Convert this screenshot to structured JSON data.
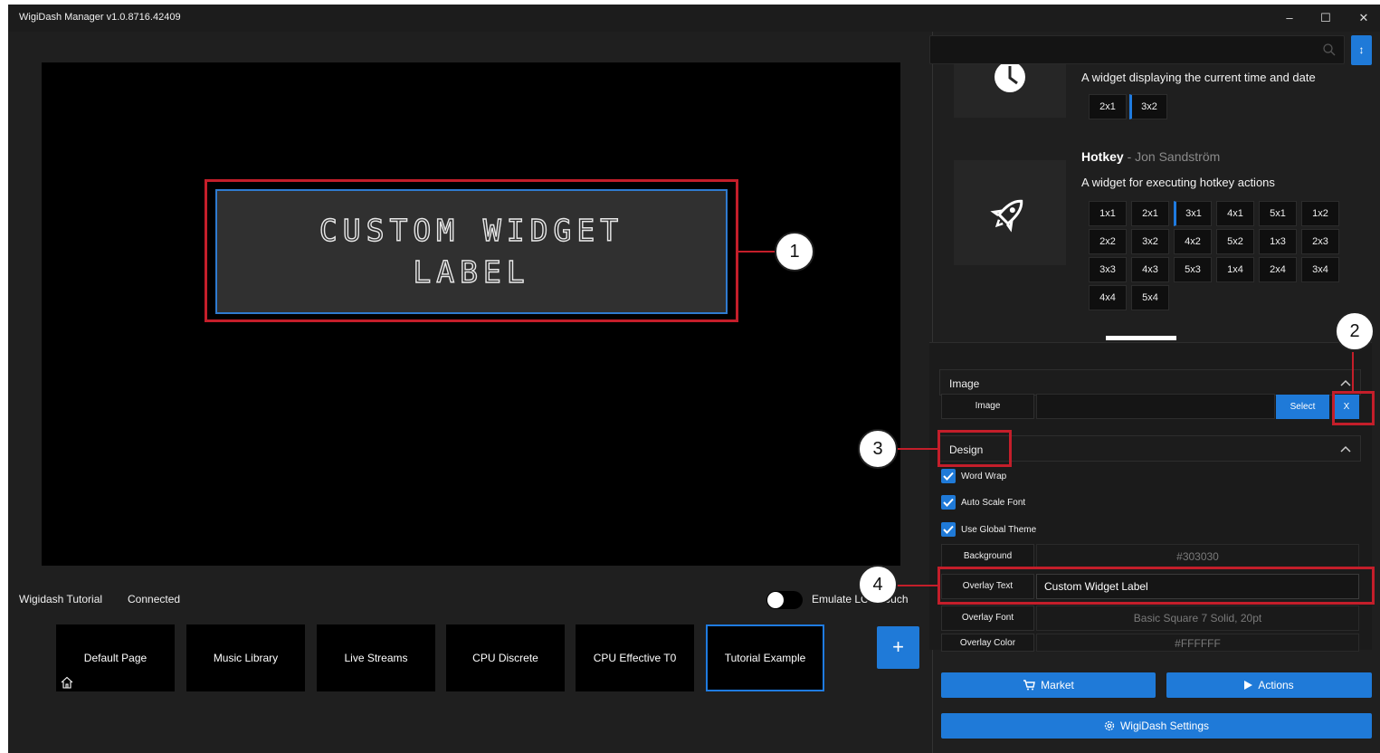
{
  "window": {
    "title": "WigiDash Manager v1.0.8716.42409",
    "minimize_glyph": "–",
    "maximize_glyph": "☐",
    "close_glyph": "✕"
  },
  "preview": {
    "widget_text": "Custom Widget Label"
  },
  "status": {
    "device_name": "Wigidash Tutorial",
    "connection": "Connected",
    "emulate_label": "Emulate LCD Touch"
  },
  "pages": [
    {
      "label": "Default Page",
      "home": true
    },
    {
      "label": "Music Library"
    },
    {
      "label": "Live Streams"
    },
    {
      "label": "CPU Discrete"
    },
    {
      "label": "CPU Effective T0"
    },
    {
      "label": "Tutorial Example",
      "active": true
    }
  ],
  "add_page_label": "+",
  "search": {
    "placeholder": "",
    "side_button": "↕"
  },
  "widgets": {
    "clock": {
      "description": "A widget displaying the current time and date",
      "sizes": [
        "2x1",
        "3x2"
      ]
    },
    "hotkey": {
      "name": "Hotkey",
      "author": " - Jon Sandström",
      "description": "A widget for executing hotkey actions",
      "sizes": [
        "1x1",
        "2x1",
        "3x1",
        "4x1",
        "5x1",
        "1x2",
        "2x2",
        "3x2",
        "4x2",
        "5x2",
        "1x3",
        "2x3",
        "3x3",
        "4x3",
        "5x3",
        "1x4",
        "2x4",
        "3x4",
        "4x4",
        "5x4"
      ]
    }
  },
  "properties": {
    "image_section": "Image",
    "image_label": "Image",
    "select_button": "Select",
    "clear_button": "X",
    "design_section": "Design",
    "word_wrap": "Word Wrap",
    "auto_scale": "Auto Scale Font",
    "global_theme": "Use Global Theme",
    "background_label": "Background",
    "background_value": "#303030",
    "overlay_text_label": "Overlay Text",
    "overlay_text_value": "Custom Widget Label",
    "overlay_font_label": "Overlay Font",
    "overlay_font_value": "Basic Square 7 Solid, 20pt",
    "overlay_color_label": "Overlay Color",
    "overlay_color_value": "#FFFFFF"
  },
  "buttons": {
    "market": "Market",
    "actions": "Actions",
    "settings": "WigiDash Settings"
  },
  "annotations": [
    "1",
    "2",
    "3",
    "4"
  ],
  "colors": {
    "accent": "#1f7ad8",
    "highlight": "#c41e2a",
    "widget_background": "#303030"
  }
}
